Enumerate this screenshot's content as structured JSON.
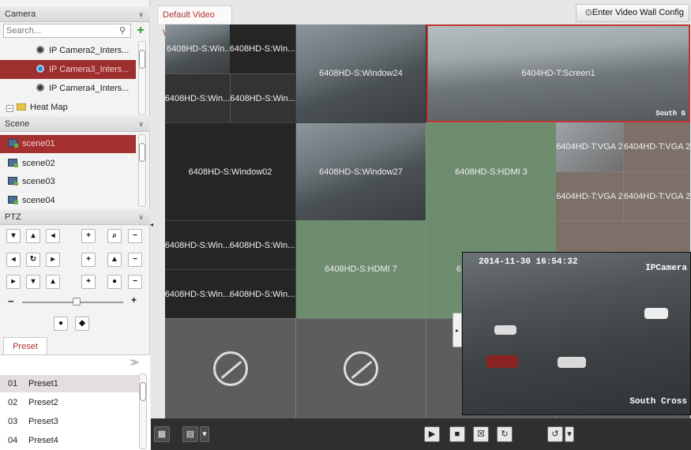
{
  "camera": {
    "header": "Camera",
    "search_placeholder": "Search...",
    "items": [
      {
        "label": "IP Camera2_Inters..."
      },
      {
        "label": "IP Camera3_Inters..."
      },
      {
        "label": "IP Camera4_Inters..."
      }
    ],
    "group": "Heat Map"
  },
  "scene": {
    "header": "Scene",
    "items": [
      "scene01",
      "scene02",
      "scene03",
      "scene04"
    ]
  },
  "ptz": {
    "header": "PTZ"
  },
  "preset": {
    "tab": "Preset",
    "items": [
      {
        "num": "01",
        "label": "Preset1"
      },
      {
        "num": "02",
        "label": "Preset2"
      },
      {
        "num": "03",
        "label": "Preset3"
      },
      {
        "num": "04",
        "label": "Preset4"
      }
    ]
  },
  "main": {
    "tab": "Default Video Wall",
    "enter_button": "Enter Video Wall Config"
  },
  "wall": {
    "labels": {
      "w_a": "6408HD-S:Win...",
      "w_b": "6408HD-S:Win...",
      "w_c": "6408HD-S:Win...",
      "w_d": "6408HD-S:Win...",
      "w24": "6408HD-S:Window24",
      "screen1": "6404HD-T:Screen1",
      "w02": "6408HD-S:Window02",
      "w27": "6408HD-S:Window27",
      "hdmi3": "6408HD-S:HDMI 3",
      "vga_a": "6404HD-T:VGA 2",
      "vga_b": "6404HD-T:VGA 2",
      "vga_c": "6404HD-T:VGA 2",
      "vga_d": "6404HD-T:VGA 2",
      "w_e": "6408HD-S:Win...",
      "w_f": "6408HD-S:Win...",
      "w_g": "6408HD-S:Win...",
      "w_h": "6408HD-S:Win...",
      "hdmi7": "6408HD-S:HDMI 7",
      "cut": "6"
    },
    "osd": {
      "screen1_cam": "South G",
      "float_time": "2014-11-30 16:54:32",
      "float_cam": "IPCamera",
      "float_loc": "South Cross"
    }
  }
}
